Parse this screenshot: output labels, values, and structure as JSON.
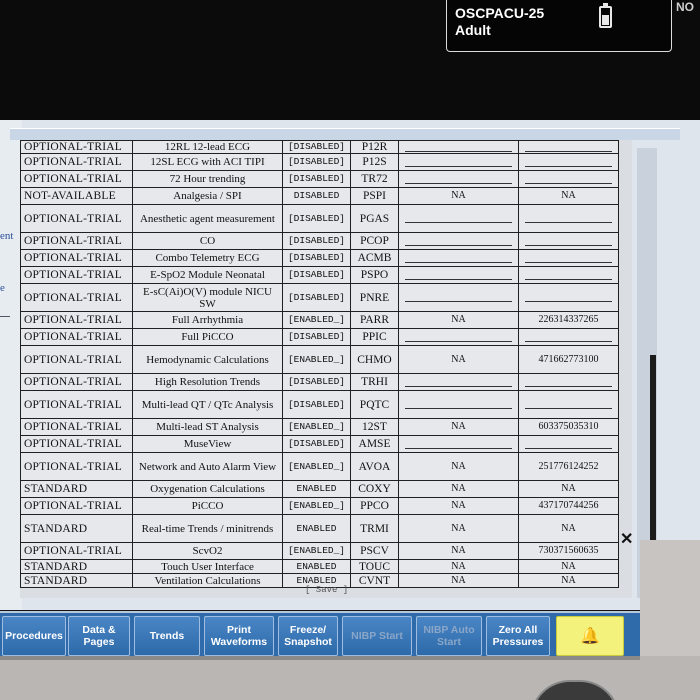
{
  "header": {
    "patient_id": "OSCPACU-25",
    "patient_type": "Adult",
    "corner_text": "NO",
    "icons": {
      "battery": "battery-icon"
    }
  },
  "left_panel": {
    "text_1": "ent",
    "text_2": "e"
  },
  "options_table": {
    "rows": [
      {
        "mode": "OPTIONAL-TRIAL",
        "option": "12RL 12-lead ECG",
        "status": "[DISABLED]",
        "code": "P12R",
        "value_1": "",
        "value_2": ""
      },
      {
        "mode": "OPTIONAL-TRIAL",
        "option": "12SL ECG with ACI TIPI",
        "status": "[DISABLED]",
        "code": "P12S",
        "value_1": "",
        "value_2": ""
      },
      {
        "mode": "OPTIONAL-TRIAL",
        "option": "72 Hour trending",
        "status": "[DISABLED]",
        "code": "TR72",
        "value_1": "",
        "value_2": ""
      },
      {
        "mode": "NOT-AVAILABLE",
        "option": "Analgesia / SPI",
        "status": "DISABLED",
        "code": "PSPI",
        "value_1": "NA",
        "value_2": "NA"
      },
      {
        "mode": "OPTIONAL-TRIAL",
        "option": "Anesthetic agent measurement",
        "status": "[DISABLED]",
        "code": "PGAS",
        "value_1": "",
        "value_2": ""
      },
      {
        "mode": "OPTIONAL-TRIAL",
        "option": "CO",
        "status": "[DISABLED]",
        "code": "PCOP",
        "value_1": "",
        "value_2": ""
      },
      {
        "mode": "OPTIONAL-TRIAL",
        "option": "Combo Telemetry ECG",
        "status": "[DISABLED]",
        "code": "ACMB",
        "value_1": "",
        "value_2": ""
      },
      {
        "mode": "OPTIONAL-TRIAL",
        "option": "E-SpO2 Module Neonatal",
        "status": "[DISABLED]",
        "code": "PSPO",
        "value_1": "",
        "value_2": ""
      },
      {
        "mode": "OPTIONAL-TRIAL",
        "option": "E-sC(Ai)O(V) module NICU SW",
        "status": "[DISABLED]",
        "code": "PNRE",
        "value_1": "",
        "value_2": ""
      },
      {
        "mode": "OPTIONAL-TRIAL",
        "option": "Full Arrhythmia",
        "status": "[ENABLED_]",
        "code": "PARR",
        "value_1": "NA",
        "value_2": "226314337265"
      },
      {
        "mode": "OPTIONAL-TRIAL",
        "option": "Full PiCCO",
        "status": "[DISABLED]",
        "code": "PPIC",
        "value_1": "",
        "value_2": ""
      },
      {
        "mode": "OPTIONAL-TRIAL",
        "option": "Hemodynamic Calculations",
        "status": "[ENABLED_]",
        "code": "CHMO",
        "value_1": "NA",
        "value_2": "471662773100"
      },
      {
        "mode": "OPTIONAL-TRIAL",
        "option": "High Resolution Trends",
        "status": "[DISABLED]",
        "code": "TRHI",
        "value_1": "",
        "value_2": ""
      },
      {
        "mode": "OPTIONAL-TRIAL",
        "option": "Multi-lead QT / QTc Analysis",
        "status": "[DISABLED]",
        "code": "PQTC",
        "value_1": "",
        "value_2": ""
      },
      {
        "mode": "OPTIONAL-TRIAL",
        "option": "Multi-lead ST Analysis",
        "status": "[ENABLED_]",
        "code": "12ST",
        "value_1": "NA",
        "value_2": "603375035310"
      },
      {
        "mode": "OPTIONAL-TRIAL",
        "option": "MuseView",
        "status": "[DISABLED]",
        "code": "AMSE",
        "value_1": "",
        "value_2": ""
      },
      {
        "mode": "OPTIONAL-TRIAL",
        "option": "Network and Auto Alarm View",
        "status": "[ENABLED_]",
        "code": "AVOA",
        "value_1": "NA",
        "value_2": "251776124252"
      },
      {
        "mode": "STANDARD",
        "option": "Oxygenation Calculations",
        "status": "ENABLED",
        "code": "COXY",
        "value_1": "NA",
        "value_2": "NA"
      },
      {
        "mode": "OPTIONAL-TRIAL",
        "option": "PiCCO",
        "status": "[ENABLED_]",
        "code": "PPCO",
        "value_1": "NA",
        "value_2": "437170744256"
      },
      {
        "mode": "STANDARD",
        "option": "Real-time Trends / minitrends",
        "status": "ENABLED",
        "code": "TRMI",
        "value_1": "NA",
        "value_2": "NA"
      },
      {
        "mode": "OPTIONAL-TRIAL",
        "option": "ScvO2",
        "status": "[ENABLED_]",
        "code": "PSCV",
        "value_1": "NA",
        "value_2": "730371560635"
      },
      {
        "mode": "STANDARD",
        "option": "Touch User Interface",
        "status": "ENABLED",
        "code": "TOUC",
        "value_1": "NA",
        "value_2": "NA"
      },
      {
        "mode": "STANDARD",
        "option": "Ventilation Calculations",
        "status": "ENABLED",
        "code": "CVNT",
        "value_1": "NA",
        "value_2": "NA"
      }
    ]
  },
  "save_label": "[ Save ]",
  "close_symbol": "✕",
  "softkeys": [
    {
      "label": "Procedures",
      "enabled": true
    },
    {
      "label": "Data & Pages",
      "enabled": true
    },
    {
      "label": "Trends",
      "enabled": true
    },
    {
      "label": "Print Waveforms",
      "enabled": true
    },
    {
      "label": "Freeze/ Snapshot",
      "enabled": true
    },
    {
      "label": "NIBP Start",
      "enabled": false
    },
    {
      "label": "NIBP Auto Start",
      "enabled": false
    },
    {
      "label": "Zero All Pressures",
      "enabled": true
    }
  ],
  "alarm_key": {
    "icon": "alarm-bell-icon",
    "symbol": "🔔"
  }
}
